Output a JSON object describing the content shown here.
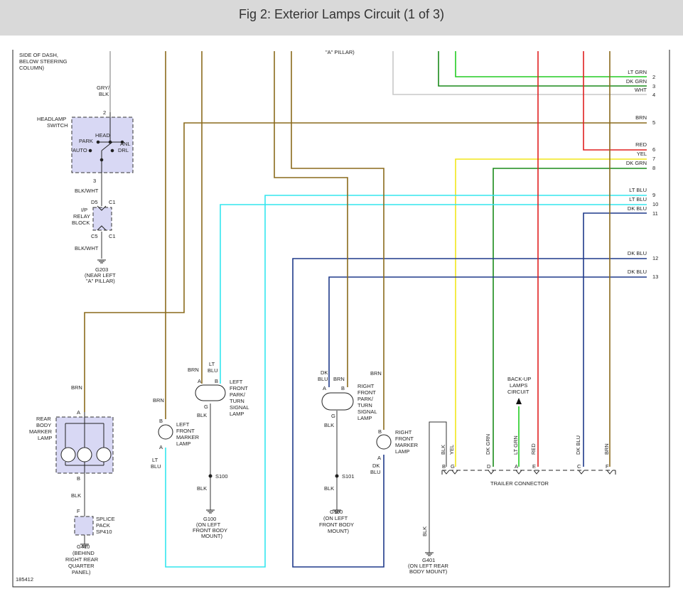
{
  "title": "Fig 2: Exterior Lamps Circuit (1 of 3)",
  "figure_number": "185412",
  "colors": {
    "brn": "#8a6a1c",
    "ltblu": "#33e6ee",
    "dkblu": "#1f3a8a",
    "ltgrn": "#22cc22",
    "dkgrn": "#1a8a1a",
    "red": "#e02020",
    "yel": "#f2e61a",
    "wht": "#c8c8c8",
    "gry": "#aaaaaa",
    "blk": "#333333"
  },
  "right_wires": [
    {
      "color": "LT GRN",
      "num": "2"
    },
    {
      "color": "DK GRN",
      "num": "3"
    },
    {
      "color": "WHT",
      "num": "4"
    },
    {
      "color": "BRN",
      "num": "5"
    },
    {
      "color": "RED",
      "num": "6"
    },
    {
      "color": "YEL",
      "num": "7"
    },
    {
      "color": "DK GRN",
      "num": "8"
    },
    {
      "color": "LT BLU",
      "num": "9"
    },
    {
      "color": "LT BLU",
      "num": "10"
    },
    {
      "color": "DK BLU",
      "num": "11"
    },
    {
      "color": "DK BLU",
      "num": "12"
    },
    {
      "color": "DK BLU",
      "num": "13"
    }
  ],
  "top_notes": {
    "dash": [
      "SIDE OF DASH,",
      "BELOW STEERING",
      "COLUMN)"
    ],
    "pillar": "\"A\" PILLAR)"
  },
  "headlamp_switch": {
    "label": [
      "HEADLAMP",
      "SWITCH"
    ],
    "wire_in": [
      "GRY/",
      "BLK"
    ],
    "pin_in": "2",
    "pin_out": "3",
    "positions": {
      "park": "PARK",
      "head": "HEAD",
      "auto": "AUTO",
      "anl": "ANL",
      "drl": "DRL"
    }
  },
  "relay_block": {
    "label": [
      "I/P",
      "RELAY",
      "BLOCK"
    ],
    "wire_top": "BLK/WHT",
    "wire_bottom": "BLK/WHT",
    "pins": {
      "d5": "D5",
      "c5": "C5",
      "c1a": "C1",
      "c1b": "C1"
    }
  },
  "g203": {
    "id": "G203",
    "note": [
      "(NEAR LEFT",
      "\"A\" PILLAR)"
    ]
  },
  "rear_marker": {
    "label": [
      "REAR",
      "BODY",
      "MARKER",
      "LAMP"
    ],
    "wire_top": "BRN",
    "wire_bottom": "BLK",
    "pin_a": "A",
    "pin_b": "B"
  },
  "splice_pack": {
    "label": [
      "SPLICE",
      "PACK",
      "SP410"
    ],
    "pin": "F",
    "ground": "G410",
    "note": [
      "(BEHIND",
      "RIGHT REAR",
      "QUARTER",
      "PANEL)"
    ]
  },
  "left_front_marker": {
    "label": [
      "LEFT",
      "FRONT",
      "MARKER",
      "LAMP"
    ],
    "wire_top": "BRN",
    "pin_b": "B",
    "pin_a": "A",
    "wire_bottom": [
      "LT",
      "BLU"
    ]
  },
  "left_front_park": {
    "label": [
      "LEFT",
      "FRONT",
      "PARK/",
      "TURN",
      "SIGNAL",
      "LAMP"
    ],
    "wire1": "BRN",
    "wire2": [
      "LT",
      "BLU"
    ],
    "pin_a": "A",
    "pin_b": "B",
    "pin_g": "G",
    "wire_gnd": "BLK",
    "splice": "S100",
    "wire_gnd2": "BLK",
    "ground": "G100",
    "note": [
      "(ON LEFT",
      "FRONT BODY",
      "MOUNT)"
    ]
  },
  "right_front_park": {
    "label": [
      "RIGHT",
      "FRONT",
      "PARK/",
      "TURN",
      "SIGNAL",
      "LAMP"
    ],
    "wire1": [
      "DK",
      "BLU"
    ],
    "wire2": "BRN",
    "pin_a": "A",
    "pin_b": "B",
    "pin_g": "G",
    "wire_gnd": "BLK",
    "splice": "S101",
    "wire_gnd2": "BLK",
    "ground": "G100",
    "note": [
      "(ON LEFT",
      "FRONT BODY",
      "MOUNT)"
    ]
  },
  "right_front_marker": {
    "label": [
      "RIGHT",
      "FRONT",
      "MARKER",
      "LAMP"
    ],
    "wire_top": "BRN",
    "pin_b": "B",
    "pin_a": "A",
    "wire_bottom": [
      "DK",
      "BLU"
    ]
  },
  "backup": {
    "label": [
      "BACK-UP",
      "LAMPS",
      "CIRCUIT"
    ]
  },
  "trailer": {
    "label": "TRAILER CONNECTOR",
    "pins": [
      {
        "pin": "B",
        "wire": "BLK"
      },
      {
        "pin": "G",
        "wire": "YEL"
      },
      {
        "pin": "D",
        "wire": "DK GRN"
      },
      {
        "pin": "A",
        "wire": "LT GRN"
      },
      {
        "pin": "E",
        "wire": "RED"
      },
      {
        "pin": "C",
        "wire": "DK BLU"
      },
      {
        "pin": "F",
        "wire": "BRN"
      }
    ]
  },
  "g401": {
    "wire": "BLK",
    "id": "G401",
    "note": [
      "(ON LEFT REAR",
      "BODY MOUNT)"
    ]
  }
}
